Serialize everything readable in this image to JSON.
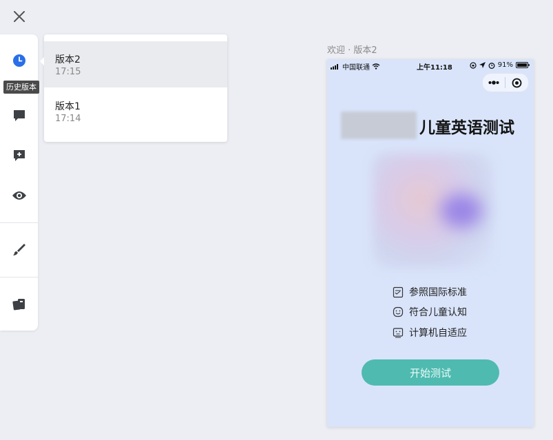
{
  "tooltip": {
    "history_version": "历史版本"
  },
  "versions": [
    {
      "name": "版本2",
      "time": "17:15"
    },
    {
      "name": "版本1",
      "time": "17:14"
    }
  ],
  "preview": {
    "label": "欢迎 · 版本2",
    "status_bar": {
      "carrier": "中国联通",
      "time": "上午11:18",
      "battery": "91%"
    },
    "title": "儿童英语测试",
    "features": [
      "参照国际标准",
      "符合儿童认知",
      "计算机自适应"
    ],
    "start_button": "开始测试"
  },
  "colors": {
    "accent_blue": "#2a6ee8",
    "preview_bg": "#d9e4fa",
    "start_button": "#4fbab0"
  }
}
